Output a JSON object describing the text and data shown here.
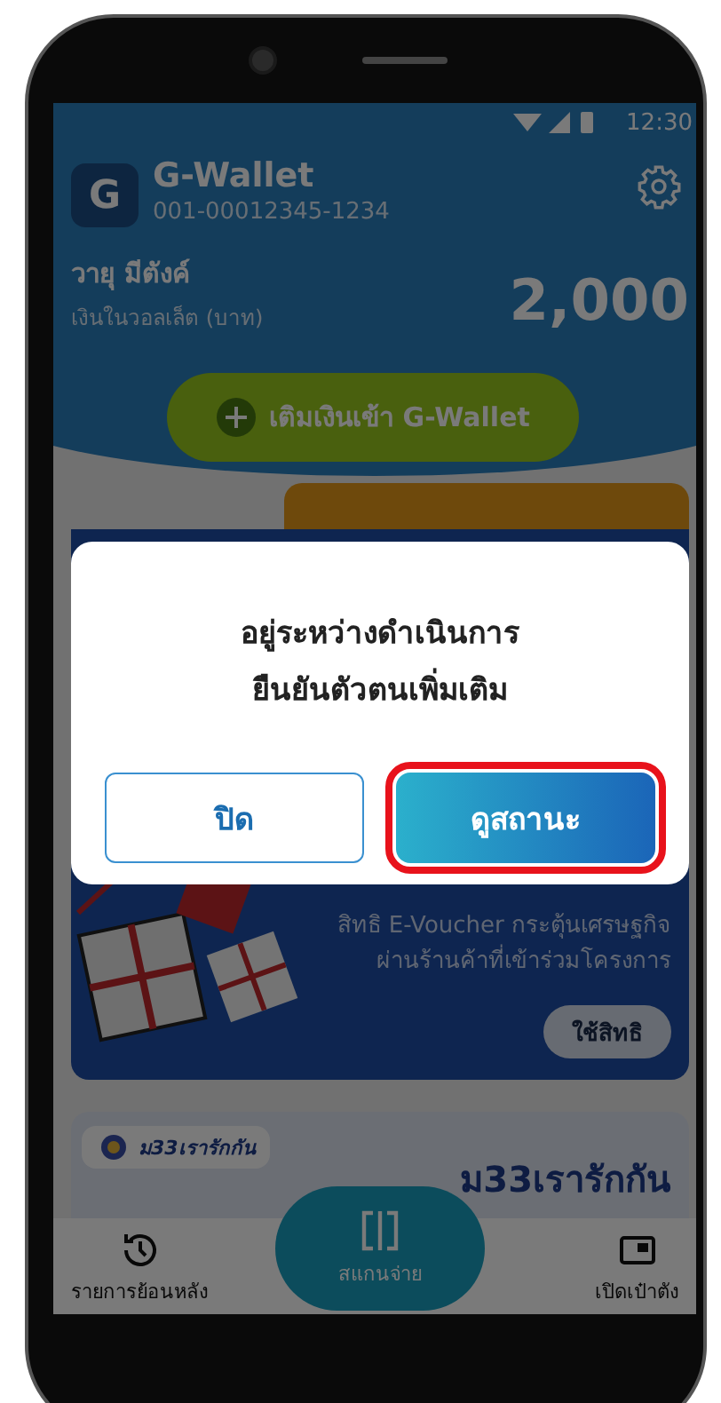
{
  "status_bar": {
    "time": "12:30"
  },
  "wallet": {
    "logo": "G",
    "title": "G-Wallet",
    "account": "001-00012345-1234",
    "owner": "วายุ มีตังค์",
    "balance_label": "เงินในวอลเล็ต (บาท)",
    "balance": "2,000",
    "topup_button": "เติมเงินเข้า G-Wallet"
  },
  "voucher_card": {
    "lines": [
      "สิทธิ E-Voucher กระตุ้นเศรษฐกิจ",
      "ผ่านร้านค้าที่เข้าร่วมโครงการ"
    ],
    "button": "ใช้สิทธิ"
  },
  "promo_card": {
    "tag": "ม33เรารักกัน",
    "title": "ม33เรารักกัน"
  },
  "bottom_nav": [
    {
      "label": "รายการย้อนหลัง",
      "kind": "history"
    },
    {
      "label": "สแกนจ่าย",
      "kind": "scan"
    },
    {
      "label": "เปิดเป๋าตัง",
      "kind": "wallet"
    }
  ],
  "dialog": {
    "message_lines": [
      "อยู่ระหว่างดำเนินการ",
      "ยืนยันตัวตนเพิ่มเติม"
    ],
    "buttons": [
      {
        "label": "ปิด",
        "kind": "secondary",
        "highlighted": false
      },
      {
        "label": "ดูสถานะ",
        "kind": "primary",
        "highlighted": true
      }
    ]
  }
}
